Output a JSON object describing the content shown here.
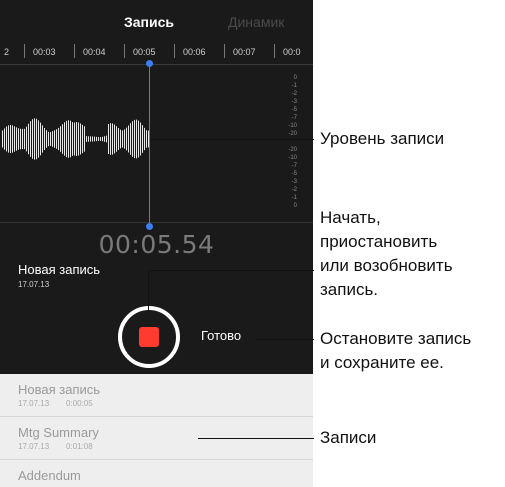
{
  "tabs": {
    "record": "Запись",
    "speaker": "Динамик"
  },
  "timeline": [
    "2",
    "00:03",
    "00:04",
    "00:05",
    "00:06",
    "00:07",
    "00:0"
  ],
  "level_scale": [
    "0",
    "-1",
    "-2",
    "-3",
    "-5",
    "-7",
    "-10",
    "-20",
    "",
    "-20",
    "-10",
    "-7",
    "-5",
    "-3",
    "-2",
    "-1",
    "0"
  ],
  "timer": "00:05.54",
  "current_recording": {
    "title": "Новая запись",
    "date": "17.07.13"
  },
  "done_label": "Готово",
  "recordings": [
    {
      "title": "Новая запись",
      "date": "17.07.13",
      "duration": "0:00:05"
    },
    {
      "title": "Mtg Summary",
      "date": "17.07.13",
      "duration": "0:01:08"
    },
    {
      "title": "Addendum",
      "date": "",
      "duration": ""
    }
  ],
  "callouts": {
    "level": "Уровень записи",
    "start_line1": "Начать,",
    "start_line2": "приостановить",
    "start_line3": "или возобновить",
    "start_line4": "запись.",
    "stop_line1": "Остановите запись",
    "stop_line2": "и сохраните ее.",
    "recordings": "Записи"
  },
  "colors": {
    "cursor": "#3b7ff0",
    "record": "#ff3b30",
    "background": "#1a1a1a"
  }
}
